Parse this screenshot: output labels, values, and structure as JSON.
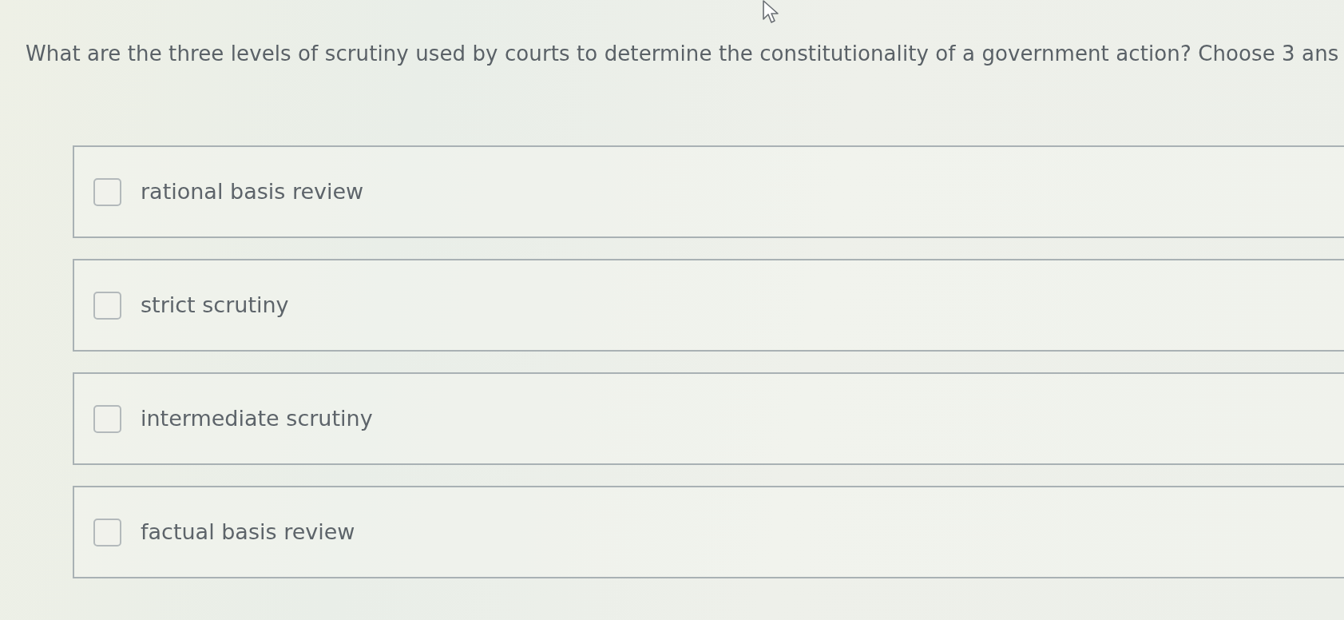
{
  "question": {
    "text": "What are the three levels of scrutiny used by courts to determine the constitutionality of a government action? Choose 3 ans"
  },
  "options": [
    {
      "label": "rational basis review",
      "checked": false
    },
    {
      "label": "strict scrutiny",
      "checked": false
    },
    {
      "label": "intermediate scrutiny",
      "checked": false
    },
    {
      "label": "factual basis review",
      "checked": false
    }
  ]
}
